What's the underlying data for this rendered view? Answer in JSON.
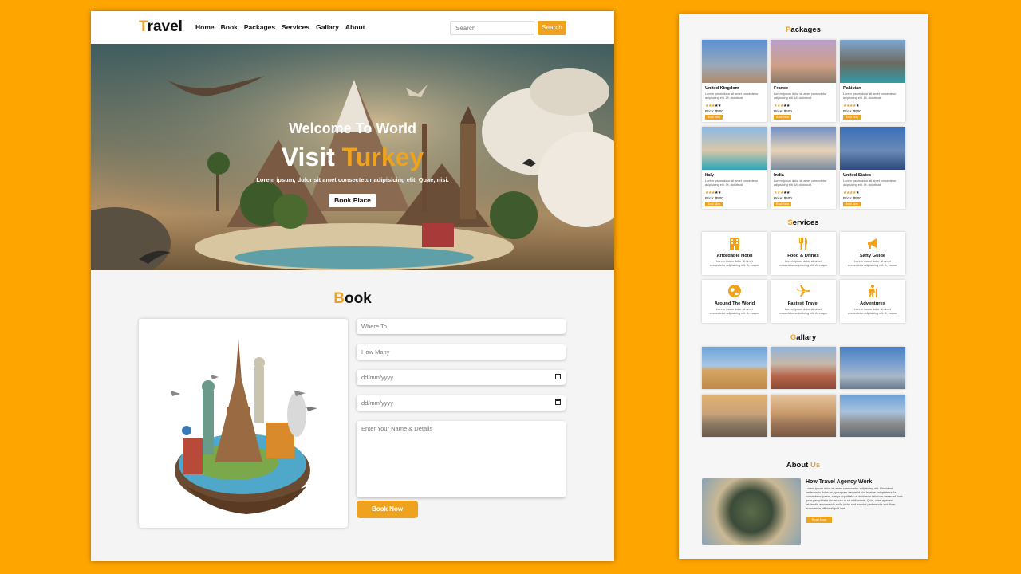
{
  "nav": {
    "logo_first": "T",
    "logo_rest": "ravel",
    "links": [
      "Home",
      "Book",
      "Packages",
      "Services",
      "Gallary",
      "About"
    ],
    "search_placeholder": "Search",
    "search_button": "Search"
  },
  "hero": {
    "welcome": "Welcome To World",
    "visit": "Visit",
    "country": "Turkey",
    "lorem": "Lorem ipsum, dolor sit amet consectetur adipisicing elit. Quae, nisi.",
    "button": "Book Place"
  },
  "book": {
    "title_first": "B",
    "title_rest": "ook",
    "where_placeholder": "Where To",
    "how_many_placeholder": "How Many",
    "date_from": "dd/mm/yyyy",
    "date_to": "dd/mm/yyyy",
    "details_placeholder": "Enter Your Name & Details",
    "submit": "Book Now"
  },
  "packages": {
    "title_first": "P",
    "title_rest": "ackages",
    "description": "Lorem ipsum dolor sit amet consectetur adipisicing elit. Ut, dolorbust",
    "price": "Price: $500",
    "button": "Book Now",
    "items": [
      {
        "name": "United Kingdom",
        "rating": 3,
        "colors": [
          "#5b8fd6",
          "#9aa9b8",
          "#b08968"
        ]
      },
      {
        "name": "France",
        "rating": 3,
        "colors": [
          "#b8a0c9",
          "#cf9f86",
          "#8a7a6a"
        ]
      },
      {
        "name": "Pakistan",
        "rating": 4,
        "colors": [
          "#7fa7d1",
          "#6b6a5e",
          "#2f9ca8"
        ]
      },
      {
        "name": "Italy",
        "rating": 3,
        "colors": [
          "#8bb9e4",
          "#d9c7a8",
          "#2aa7b8"
        ]
      },
      {
        "name": "India",
        "rating": 3,
        "colors": [
          "#6f8fc7",
          "#e8d3b8",
          "#7a8aa0"
        ]
      },
      {
        "name": "United States",
        "rating": 4,
        "colors": [
          "#3a6fb8",
          "#6a8ab8",
          "#2d4a7a"
        ]
      }
    ]
  },
  "services": {
    "title_first": "S",
    "title_rest": "ervices",
    "description": "Lorem ipsum dolor sit amet consectetur adipisicing elit. A, eaque.",
    "items": [
      {
        "name": "Affordable Hotel",
        "icon": "hotel-icon"
      },
      {
        "name": "Food & Drinks",
        "icon": "utensils-icon"
      },
      {
        "name": "Safty Guide",
        "icon": "megaphone-icon"
      },
      {
        "name": "Around The World",
        "icon": "globe-icon"
      },
      {
        "name": "Fastest Travel",
        "icon": "plane-icon"
      },
      {
        "name": "Adventures",
        "icon": "hiker-icon"
      }
    ]
  },
  "gallery": {
    "title_first": "G",
    "title_rest": "allary",
    "images": [
      {
        "label": "pyramids",
        "colors": [
          "#6ea3d8",
          "#d6a665"
        ]
      },
      {
        "label": "city-rooftops",
        "colors": [
          "#8fb3d9",
          "#b5654a"
        ]
      },
      {
        "label": "skyline",
        "colors": [
          "#4a7fc0",
          "#a9b8c9"
        ]
      },
      {
        "label": "paris",
        "colors": [
          "#e3b26e",
          "#6b5a4a"
        ]
      },
      {
        "label": "balloons",
        "colors": [
          "#c89a6a",
          "#7a5a44"
        ]
      },
      {
        "label": "istanbul",
        "colors": [
          "#6aa0d6",
          "#8a8a8a"
        ]
      }
    ]
  },
  "about": {
    "title_rest": "About",
    "title_accent": "Us",
    "heading": "How Travel Agency Work",
    "text": "Lorem ipsum dolor sit amet consectetur adipisicing elit. Provident perferendis dolorum, quisquam earum id sint beatae voluptate nulla consectetur ipsam, saepe cupiditate ut architecto laborum deserunt. Iure quos perspiciatis ipsam iure id sit nihil omnis. Quia, vitae aperiam reiciendis assumenda nulla iusto, sed eveniet perferendis sint illum accusamus officia aliquid sint.",
    "button": "Read More"
  },
  "colors": {
    "accent": "#EFA21E",
    "background": "#FFA500"
  }
}
